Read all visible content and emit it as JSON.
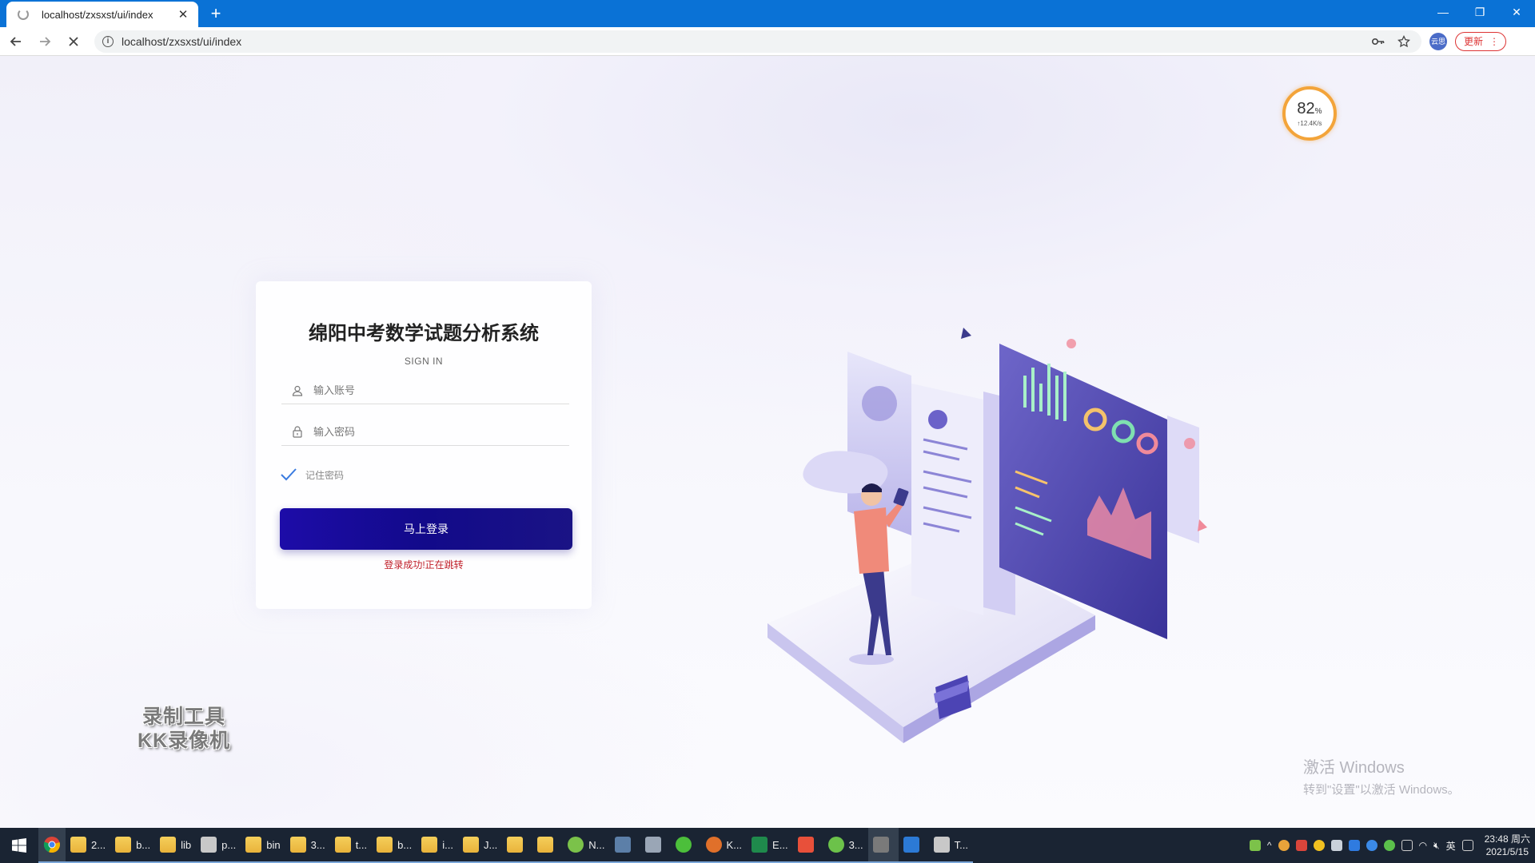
{
  "browser": {
    "tab_title": "localhost/zxsxst/ui/index",
    "url": "localhost/zxsxst/ui/index",
    "update_label": "更新",
    "profile_label": "云思"
  },
  "speed_widget": {
    "percent": "82",
    "unit": "%",
    "rate": "↑12.4K/s"
  },
  "login": {
    "title": "绵阳中考数学试题分析系统",
    "subtitle": "SIGN IN",
    "account_placeholder": "输入账号",
    "password_placeholder": "输入密码",
    "remember_label": "记住密码",
    "remember_checked": true,
    "submit_label": "马上登录",
    "status_message": "登录成功!正在跳转"
  },
  "watermark": {
    "line1": "录制工具",
    "line2": "KK录像机"
  },
  "activation": {
    "title": "激活 Windows",
    "subtitle": "转到\"设置\"以激活 Windows。"
  },
  "taskbar": {
    "items": [
      {
        "label": "2...",
        "icon": "folder-icon"
      },
      {
        "label": "b...",
        "icon": "folder-icon"
      },
      {
        "label": "lib",
        "icon": "folder-icon"
      },
      {
        "label": "p...",
        "icon": "app-icon"
      },
      {
        "label": "bin",
        "icon": "folder-icon"
      },
      {
        "label": "3...",
        "icon": "folder-icon"
      },
      {
        "label": "t...",
        "icon": "folder-icon"
      },
      {
        "label": "b...",
        "icon": "folder-icon"
      },
      {
        "label": "i...",
        "icon": "folder-icon"
      },
      {
        "label": "J...",
        "icon": "folder-icon"
      },
      {
        "label": "",
        "icon": "folder-icon"
      },
      {
        "label": "",
        "icon": "folder-icon"
      },
      {
        "label": "N...",
        "icon": "notepad-icon"
      },
      {
        "label": "",
        "icon": "calculator-icon"
      },
      {
        "label": "",
        "icon": "link-icon"
      },
      {
        "label": "",
        "icon": "wechat-icon"
      },
      {
        "label": "K...",
        "icon": "recorder-icon"
      },
      {
        "label": "E...",
        "icon": "excel-icon"
      },
      {
        "label": "",
        "icon": "media-icon"
      },
      {
        "label": "3...",
        "icon": "browser-360-icon"
      },
      {
        "label": "",
        "icon": "image-icon"
      },
      {
        "label": "",
        "icon": "vscode-icon"
      },
      {
        "label": "T...",
        "icon": "app-icon"
      }
    ],
    "ime_label": "英",
    "time": "23:48 周六",
    "date": "2021/5/15"
  },
  "colors": {
    "accent": "#1d0ca8",
    "message": "#c0202a",
    "chrome_blue": "#0a72d6"
  }
}
